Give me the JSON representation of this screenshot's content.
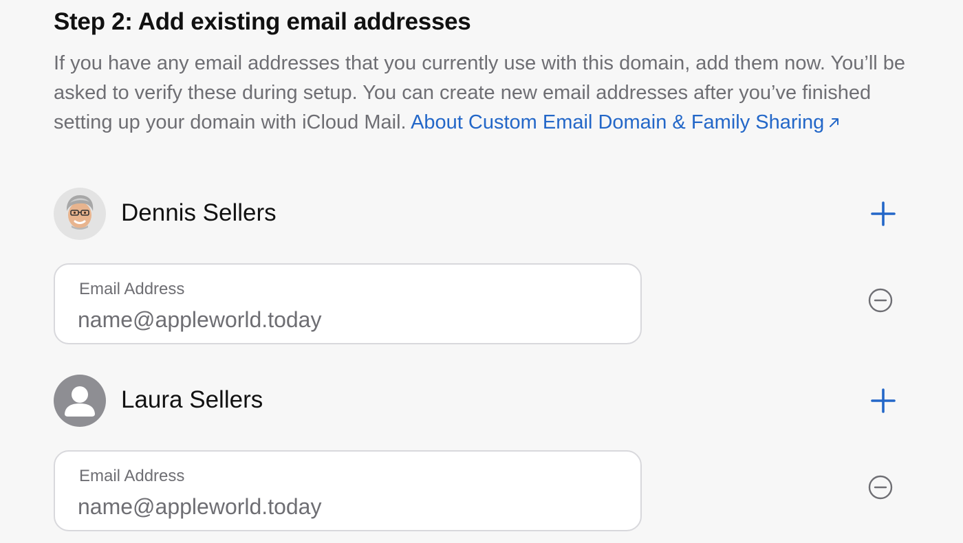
{
  "step": {
    "title": "Step 2: Add existing email addresses",
    "description": "If you have any email addresses that you currently use with this domain, add them now. You’ll be asked to verify these during setup. You can create new email addresses after you’ve finished setting up your domain with iCloud Mail.",
    "link_text": "About Custom Email Domain & Family Sharing"
  },
  "members": [
    {
      "name": "Dennis Sellers",
      "avatar": "memoji-avatar",
      "email_field": {
        "label": "Email Address",
        "placeholder": "name@appleworld.today",
        "value": ""
      }
    },
    {
      "name": "Laura Sellers",
      "avatar": "generic-person-avatar",
      "email_field": {
        "label": "Email Address",
        "placeholder": "name@appleworld.today",
        "value": ""
      }
    }
  ],
  "icons": {
    "add": "plus-icon",
    "remove": "minus-circle-icon",
    "external_link": "arrow-up-right-icon"
  },
  "colors": {
    "accent": "#2367c8",
    "secondary_text": "#6e6e73",
    "background": "#f7f7f7"
  }
}
